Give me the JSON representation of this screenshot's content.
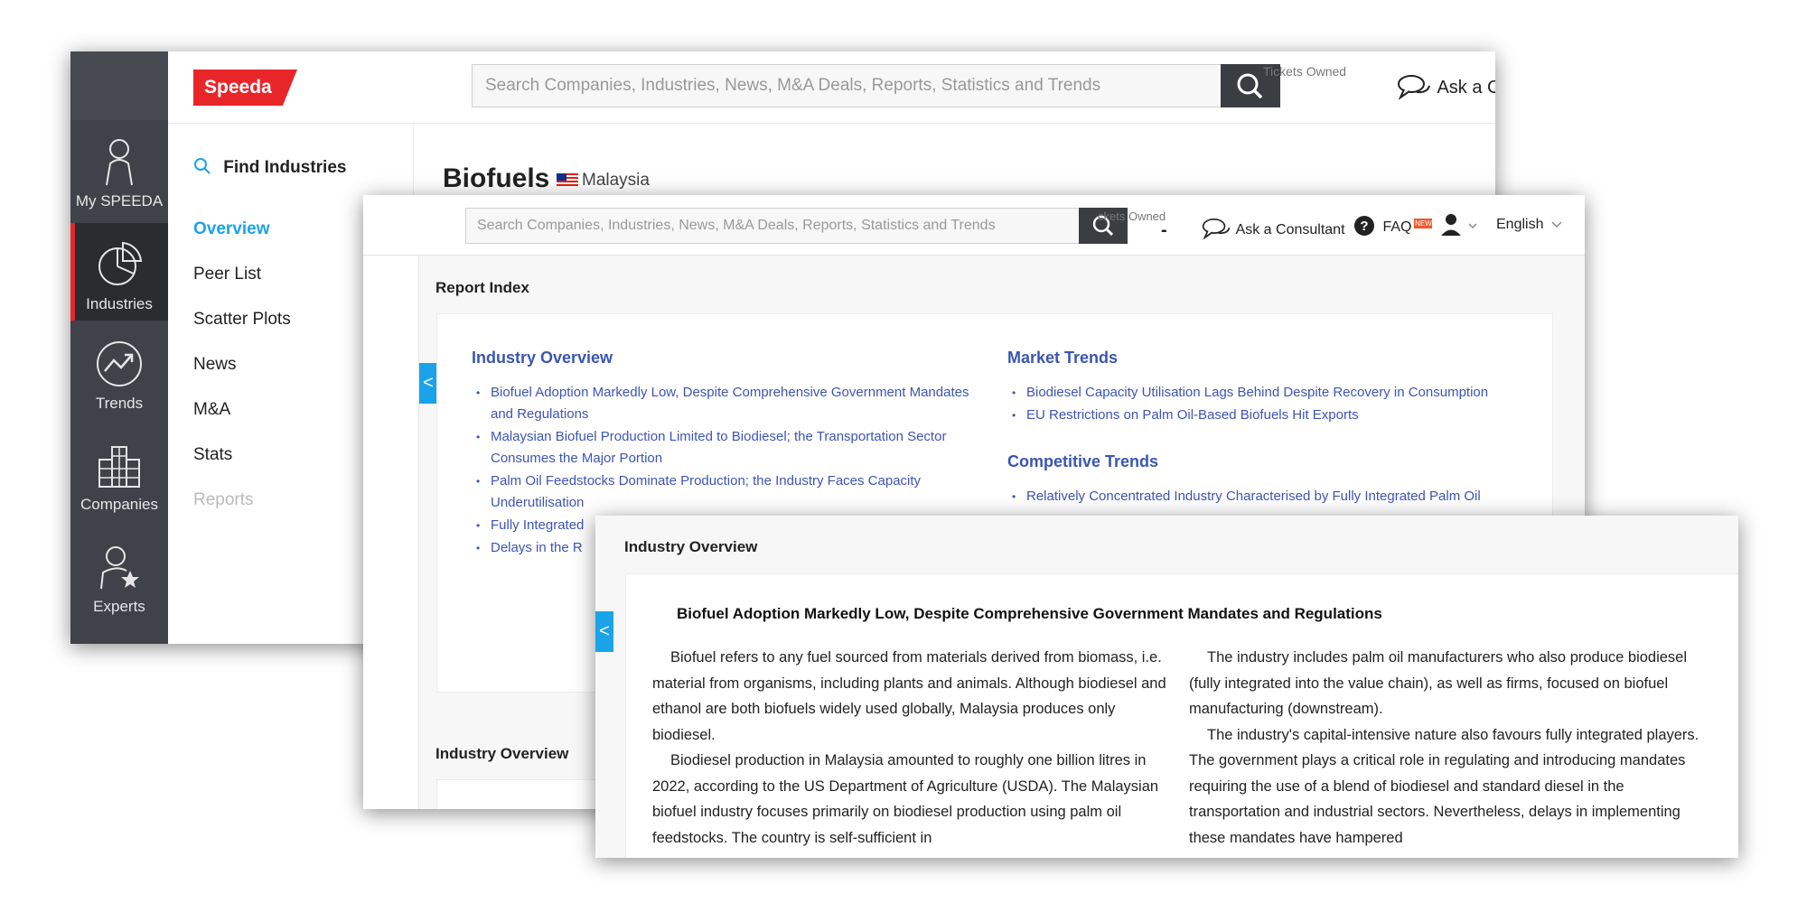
{
  "win1": {
    "logo": "Speeda",
    "search_placeholder": "Search Companies, Industries, News, M&A Deals, Reports, Statistics and Trends",
    "tickets_label": "Tickets Owned",
    "ask_consultant": "Ask a Consultant",
    "rail": [
      {
        "label": "My SPEEDA",
        "icon": "person-icon"
      },
      {
        "label": "Industries",
        "icon": "pie-chart-icon"
      },
      {
        "label": "Trends",
        "icon": "trend-arrow-icon"
      },
      {
        "label": "Companies",
        "icon": "buildings-icon"
      },
      {
        "label": "Experts",
        "icon": "expert-icon"
      }
    ],
    "find_industries": "Find Industries",
    "nav": [
      "Overview",
      "Peer List",
      "Scatter Plots",
      "News",
      "M&A",
      "Stats",
      "Reports"
    ],
    "page_title": "Biofuels",
    "country": "Malaysia"
  },
  "win2": {
    "search_placeholder": "Search Companies, Industries, News, M&A Deals, Reports, Statistics and Trends",
    "tickets_label": "ckets Owned",
    "tickets_value": "-",
    "ask_consultant": "Ask a Consultant",
    "faq": "FAQ",
    "faq_badge": "NEW",
    "language": "English",
    "report_index_title": "Report Index",
    "industry_overview_head": "Industry Overview",
    "industry_overview_links": [
      "Biofuel Adoption Markedly Low, Despite Comprehensive Government Mandates and Regulations",
      "Malaysian Biofuel Production Limited to Biodiesel; the Transportation Sector Consumes the Major Portion",
      "Palm Oil Feedstocks Dominate Production; the Industry Faces Capacity Underutilisation",
      "Fully Integrated",
      "Delays in the R"
    ],
    "market_trends_head": "Market Trends",
    "market_trends_links": [
      "Biodiesel Capacity Utilisation Lags Behind Despite Recovery in Consumption",
      "EU Restrictions on Palm Oil-Based Biofuels Hit Exports"
    ],
    "competitive_trends_head": "Competitive Trends",
    "competitive_trends_links": [
      "Relatively Concentrated Industry Characterised by Fully Integrated Palm Oil"
    ],
    "industry_overview_section_title": "Industry Overview",
    "tab_arrow": "<"
  },
  "win3": {
    "title": "Industry Overview",
    "tab_arrow": "<",
    "heading": "Biofuel Adoption Markedly Low, Despite Comprehensive Government Mandates and Regulations",
    "col1": [
      "Biofuel refers to any fuel sourced from materials derived from biomass, i.e. material from organisms, including plants and animals. Although biodiesel and ethanol are both biofuels widely used globally, Malaysia produces only biodiesel.",
      "Biodiesel production in Malaysia amounted to roughly one billion litres in 2022, according to the US Department of Agriculture (USDA). The Malaysian biofuel industry focuses primarily on biodiesel production using palm oil feedstocks. The country is self-sufficient in"
    ],
    "col2": [
      "The industry includes palm oil manufacturers who also produce biodiesel (fully integrated into the value chain), as well as firms, focused on biofuel manufacturing (downstream).",
      "The industry's capital-intensive nature also favours fully integrated players. The government plays a critical role in regulating and introducing mandates requiring the use of a blend of biodiesel and standard diesel in the transportation and industrial sectors. Nevertheless, delays in implementing these mandates have hampered"
    ]
  },
  "colors": {
    "accent_red": "#e8262a",
    "link_blue": "#3e54b6",
    "active_blue": "#1aa3e8",
    "rail_dark": "#3f4248"
  }
}
